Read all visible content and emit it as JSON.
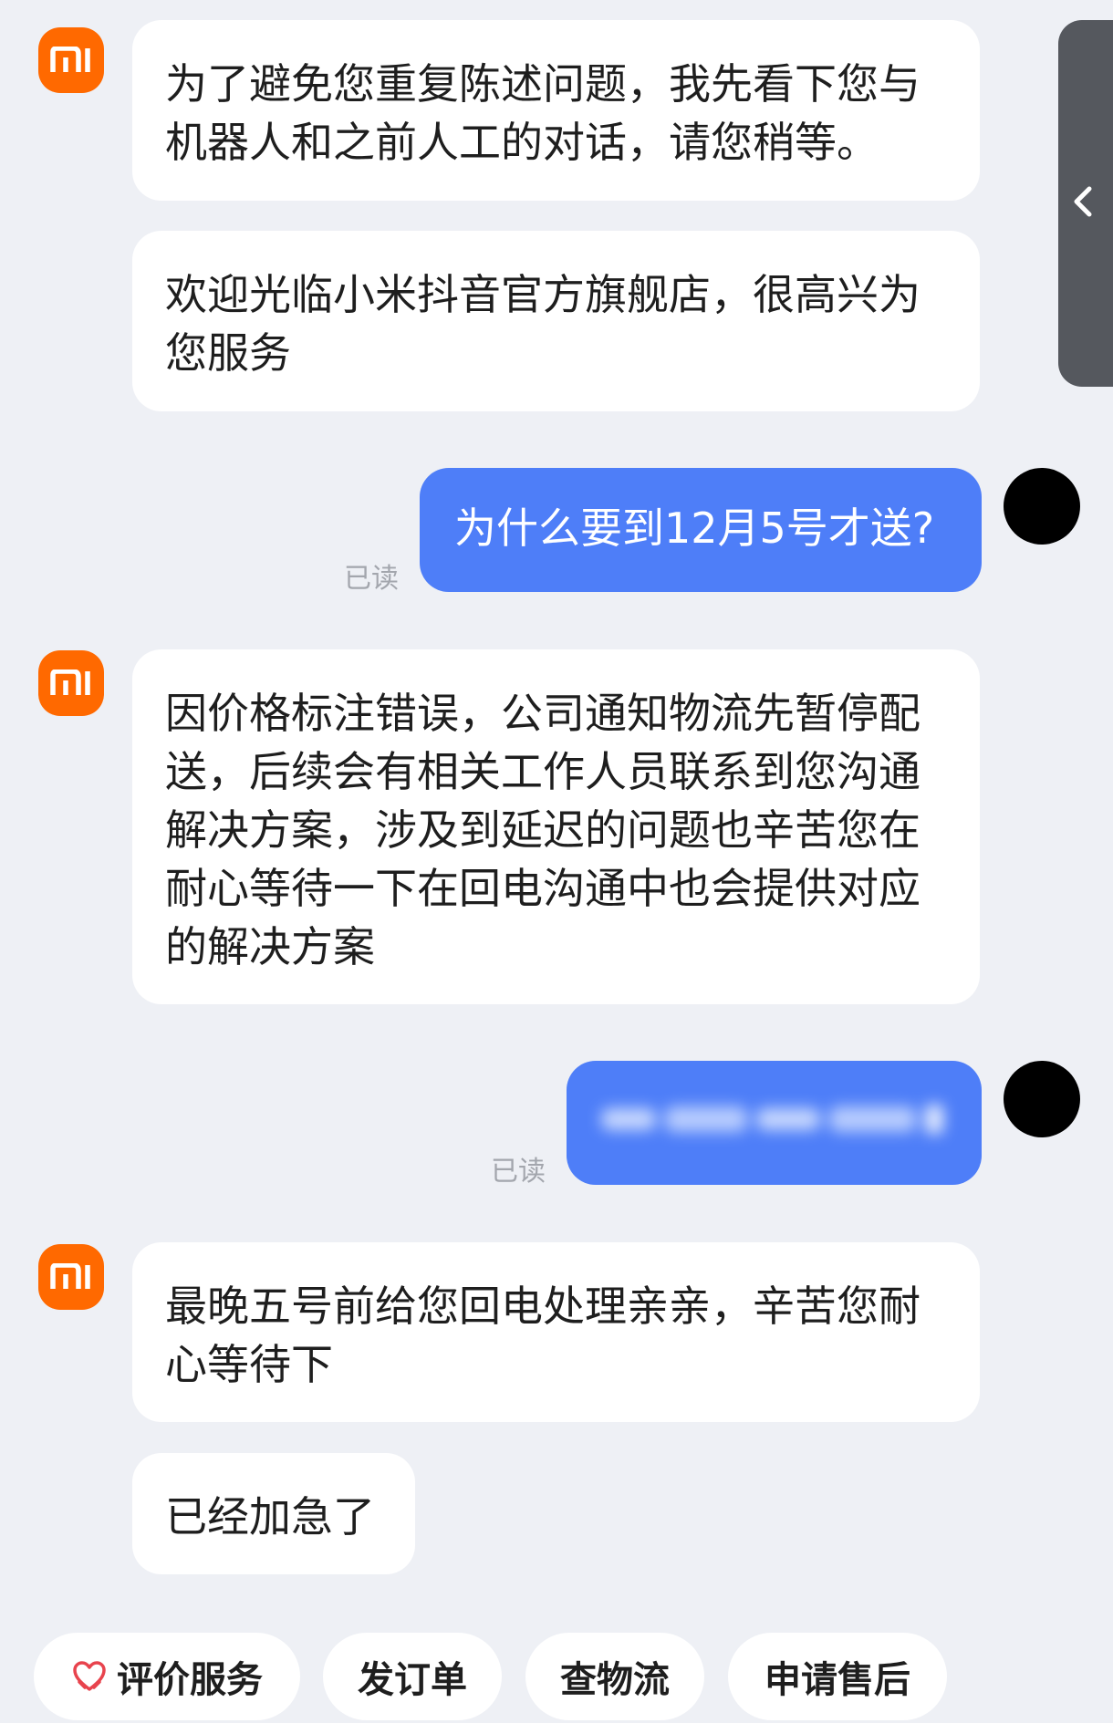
{
  "side_panel": {
    "icon": "chevron-left-icon"
  },
  "messages": [
    {
      "sender": "agent",
      "text": "为了避免您重复陈述问题，我先看下您与机器人和之前人工的对话，请您稍等。"
    },
    {
      "sender": "agent",
      "text": "欢迎光临小米抖音官方旗舰店，很高兴为您服务"
    },
    {
      "sender": "user",
      "text": "为什么要到12月5号才送?",
      "status": "已读"
    },
    {
      "sender": "agent",
      "text": "因价格标注错误，公司通知物流先暂停配送，后续会有相关工作人员联系到您沟通解决方案，涉及到延迟的问题也辛苦您在耐心等待一下在回电沟通中也会提供对应的解决方案"
    },
    {
      "sender": "user",
      "text": "",
      "status": "已读",
      "blurred": true
    },
    {
      "sender": "agent",
      "text": "最晚五号前给您回电处理亲亲，辛苦您耐心等待下"
    },
    {
      "sender": "agent",
      "text": "已经加急了"
    }
  ],
  "avatars": {
    "agent_logo": "MI",
    "agent_color": "#ff6900",
    "user_color": "#000000"
  },
  "quick_actions": [
    {
      "label": "评价服务",
      "icon": "heart-hands-icon",
      "icon_color": "#e8434d"
    },
    {
      "label": "发订单"
    },
    {
      "label": "查物流"
    },
    {
      "label": "申请售后"
    }
  ],
  "colors": {
    "background": "#eef0f5",
    "user_bubble": "#4e7ef8",
    "agent_bubble": "#ffffff"
  }
}
